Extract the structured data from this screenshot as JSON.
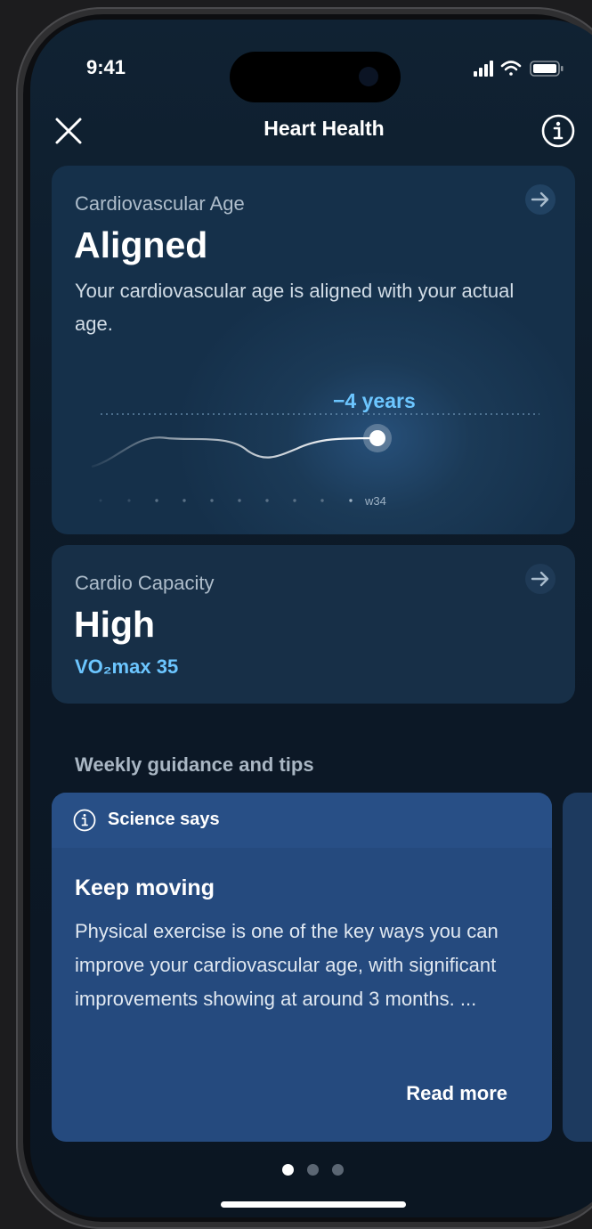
{
  "status_bar": {
    "time": "9:41"
  },
  "header": {
    "title": "Heart Health"
  },
  "cardio_age": {
    "label": "Cardiovascular Age",
    "value": "Aligned",
    "description": "Your cardiovascular age is aligned with your actual age.",
    "delta_label": "−4 years",
    "week_label": "w34",
    "accent": "#6cc6ff"
  },
  "cardio_capacity": {
    "label": "Cardio Capacity",
    "value": "High",
    "vo2_label": "VO₂max 35"
  },
  "guidance": {
    "section_title": "Weekly guidance and tips",
    "card": {
      "badge": "Science says",
      "title": "Keep moving",
      "body": "Physical exercise is one of the key ways you can improve your cardiovascular age, with significant improvements showing at around 3 months. ...",
      "link": "Read more"
    }
  },
  "pager": {
    "count": 3,
    "active": 1
  }
}
